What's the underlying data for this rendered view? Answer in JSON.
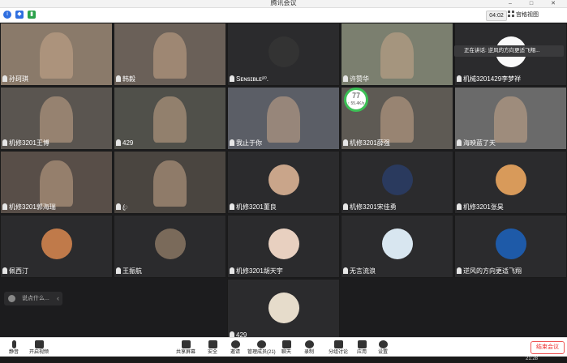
{
  "window": {
    "title": "腾讯会议"
  },
  "topbar": {
    "timer": "04:02",
    "view_label": "宫格视图"
  },
  "speaking_tip": "正在讲话: 逆风的方向更适飞翔...",
  "network_badge": {
    "percent": "77",
    "speed": "↑ 55.4K/s"
  },
  "participants": [
    {
      "name": "孙珂琪",
      "kind": "video",
      "bg": "#8a7a6a"
    },
    {
      "name": "韩毅",
      "kind": "video",
      "bg": "#6a6058"
    },
    {
      "name": "Sᴇɴsɪʙʟᴇ²⁰.",
      "kind": "avatar",
      "bg": "#2b2b2d",
      "avatar_color": "#333"
    },
    {
      "name": "许赞华",
      "kind": "video",
      "bg": "#7b7f6f"
    },
    {
      "name": "机械3201429李梦祥",
      "kind": "avatar",
      "bg": "#2b2b2d",
      "avatar_color": "#fafafa"
    },
    {
      "name": "机修3201王博",
      "kind": "video",
      "bg": "#5a5550"
    },
    {
      "name": "429",
      "kind": "video",
      "bg": "#50504a"
    },
    {
      "name": "我止于你",
      "kind": "video",
      "bg": "#5b5e66"
    },
    {
      "name": "机修3201薛强",
      "kind": "video",
      "bg": "#5e5a54"
    },
    {
      "name": "海映蓝了天",
      "kind": "video",
      "bg": "#6a6a6a"
    },
    {
      "name": "机修3201郭海瑞",
      "kind": "video",
      "bg": "#584e48"
    },
    {
      "name": "ꦿ",
      "kind": "video",
      "bg": "#4a4540"
    },
    {
      "name": "机修3201董良",
      "kind": "avatar",
      "bg": "#2b2b2d",
      "avatar_color": "#c9a58a"
    },
    {
      "name": "机修3201宋佳勇",
      "kind": "avatar",
      "bg": "#2b2b2d",
      "avatar_color": "#2a3a5e"
    },
    {
      "name": "机修3201张昊",
      "kind": "avatar",
      "bg": "#2b2b2d",
      "avatar_color": "#d89a5a"
    },
    {
      "name": "佩西汀",
      "kind": "avatar",
      "bg": "#2b2b2d",
      "avatar_color": "#c07a4a"
    },
    {
      "name": "王振航",
      "kind": "avatar",
      "bg": "#2b2b2d",
      "avatar_color": "#7a6a5a"
    },
    {
      "name": "机修3201胡天宇",
      "kind": "avatar",
      "bg": "#2b2b2d",
      "avatar_color": "#e8d0c0"
    },
    {
      "name": "无言流浪",
      "kind": "avatar",
      "bg": "#2b2b2d",
      "avatar_color": "#d8e6f0"
    },
    {
      "name": "逆风的方向更适飞翔",
      "kind": "avatar",
      "bg": "#2b2b2d",
      "avatar_color": "#1e5aa8"
    },
    {
      "name": "429",
      "kind": "avatar",
      "bg": "#2b2b2d",
      "avatar_color": "#e6dccb"
    }
  ],
  "chat": {
    "placeholder": "说点什么..."
  },
  "toolbar": {
    "mute": "静音",
    "video": "开启视频",
    "share": "共享屏幕",
    "security": "安全",
    "invite": "邀请",
    "members": "管理成员(21)",
    "chat": "聊天",
    "record": "录制",
    "breakout": "分组讨论",
    "apps": "应用",
    "settings": "设置",
    "end": "结束会议"
  },
  "taskbar": {
    "clock": "21:28"
  }
}
